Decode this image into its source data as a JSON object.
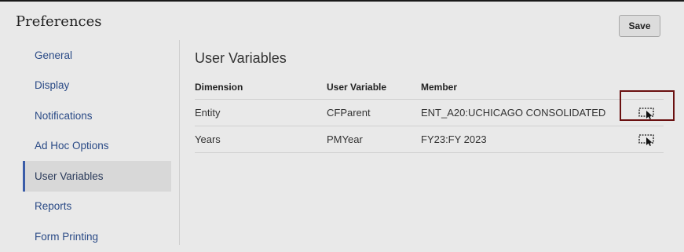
{
  "header": {
    "title": "Preferences",
    "save_label": "Save"
  },
  "sidebar": {
    "items": [
      {
        "label": "General",
        "active": false
      },
      {
        "label": "Display",
        "active": false
      },
      {
        "label": "Notifications",
        "active": false
      },
      {
        "label": "Ad Hoc Options",
        "active": false
      },
      {
        "label": "User Variables",
        "active": true
      },
      {
        "label": "Reports",
        "active": false
      },
      {
        "label": "Form Printing",
        "active": false
      }
    ]
  },
  "main": {
    "title": "User Variables",
    "columns": [
      "Dimension",
      "User Variable",
      "Member"
    ],
    "rows": [
      {
        "dimension": "Entity",
        "user_variable": "CFParent",
        "member": "ENT_A20:UCHICAGO CONSOLIDATED",
        "action_icon": "member-selector-icon",
        "highlighted": true
      },
      {
        "dimension": "Years",
        "user_variable": "PMYear",
        "member": "FY23:FY 2023",
        "action_icon": "member-selector-icon",
        "highlighted": false
      }
    ]
  },
  "colors": {
    "link": "#2a4a86",
    "active_marker": "#3a5ca8",
    "highlight_outline": "#6a1010"
  }
}
